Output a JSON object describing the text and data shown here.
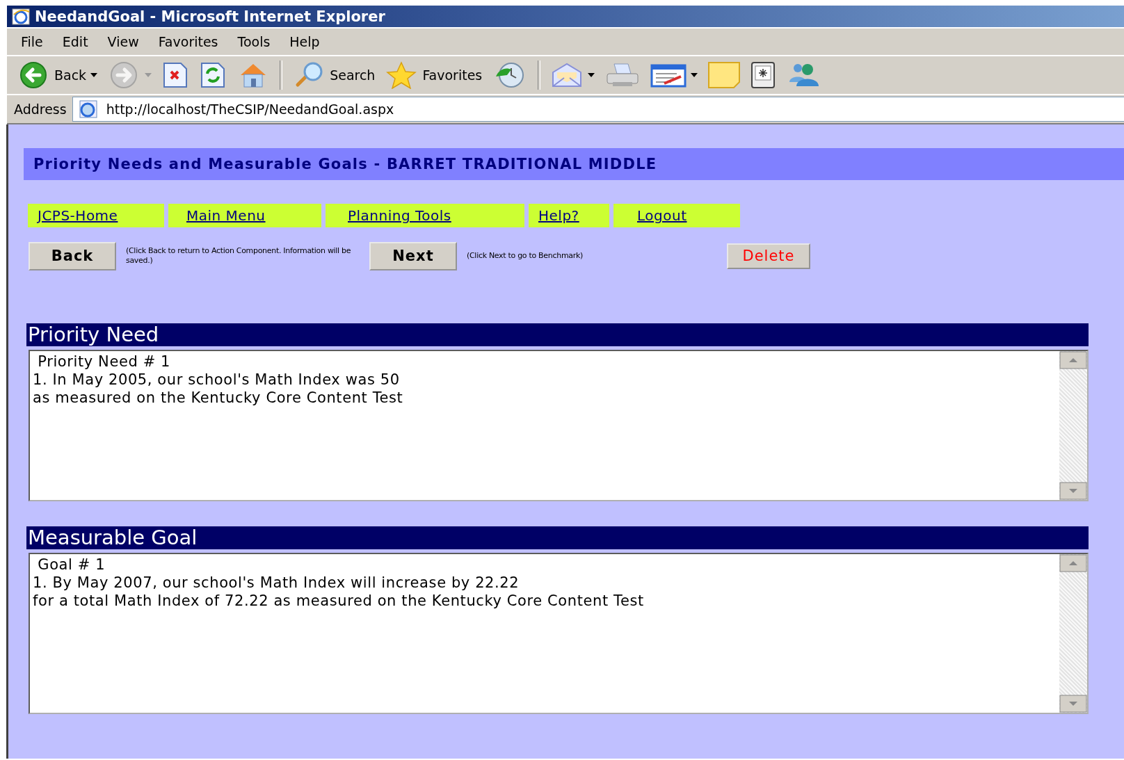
{
  "window": {
    "title": "NeedandGoal - Microsoft Internet Explorer"
  },
  "menu": [
    "File",
    "Edit",
    "View",
    "Favorites",
    "Tools",
    "Help"
  ],
  "toolbar": [
    {
      "kind": "back",
      "label": "Back",
      "disabled": false,
      "dropdown": true
    },
    {
      "kind": "forward",
      "disabled": true,
      "dropdown": true
    },
    {
      "kind": "stop",
      "disabled": false,
      "dropdown": false
    },
    {
      "kind": "refresh",
      "disabled": false,
      "dropdown": false
    },
    {
      "kind": "home",
      "disabled": false,
      "dropdown": false
    },
    {
      "kind": "search",
      "label": "Search",
      "disabled": false,
      "dropdown": false
    },
    {
      "kind": "favorites",
      "label": "Favorites",
      "disabled": false,
      "dropdown": false
    },
    {
      "kind": "history",
      "disabled": false,
      "dropdown": false
    },
    {
      "kind": "mail",
      "disabled": false,
      "dropdown": true
    },
    {
      "kind": "print",
      "disabled": false,
      "dropdown": false
    },
    {
      "kind": "edit",
      "disabled": false,
      "dropdown": true
    },
    {
      "kind": "note",
      "disabled": false,
      "dropdown": false
    },
    {
      "kind": "device",
      "disabled": false,
      "dropdown": false
    },
    {
      "kind": "messenger",
      "disabled": false,
      "dropdown": false
    }
  ],
  "address": {
    "label": "Address",
    "url": "http://localhost/TheCSIP/NeedandGoal.aspx"
  },
  "page": {
    "header": "Priority Needs and Measurable Goals - BARRET TRADITIONAL MIDDLE",
    "nav": [
      "JCPS-Home",
      "Main Menu",
      "Planning Tools",
      "Help?",
      "Logout"
    ],
    "actions": [
      {
        "kind": "button",
        "text": "Back"
      },
      {
        "kind": "hint",
        "text": "(Click Back to return to Action Component. Information will be saved.)"
      },
      {
        "kind": "button",
        "text": "Next"
      },
      {
        "kind": "hint",
        "text": "(Click Next to go to Benchmark)"
      },
      {
        "kind": "danger",
        "text": "Delete"
      }
    ],
    "sections": [
      {
        "title": "Priority Need",
        "lines": [
          " Priority Need # 1",
          "1. In May 2005, our school's Math Index was 50",
          "as measured on the Kentucky Core Content Test"
        ]
      },
      {
        "title": "Measurable Goal",
        "lines": [
          " Goal # 1",
          "1. By May 2007, our school's Math Index will increase by 22.22",
          "for a total Math Index of 72.22 as measured on the Kentucky Core Content Test"
        ]
      }
    ]
  }
}
